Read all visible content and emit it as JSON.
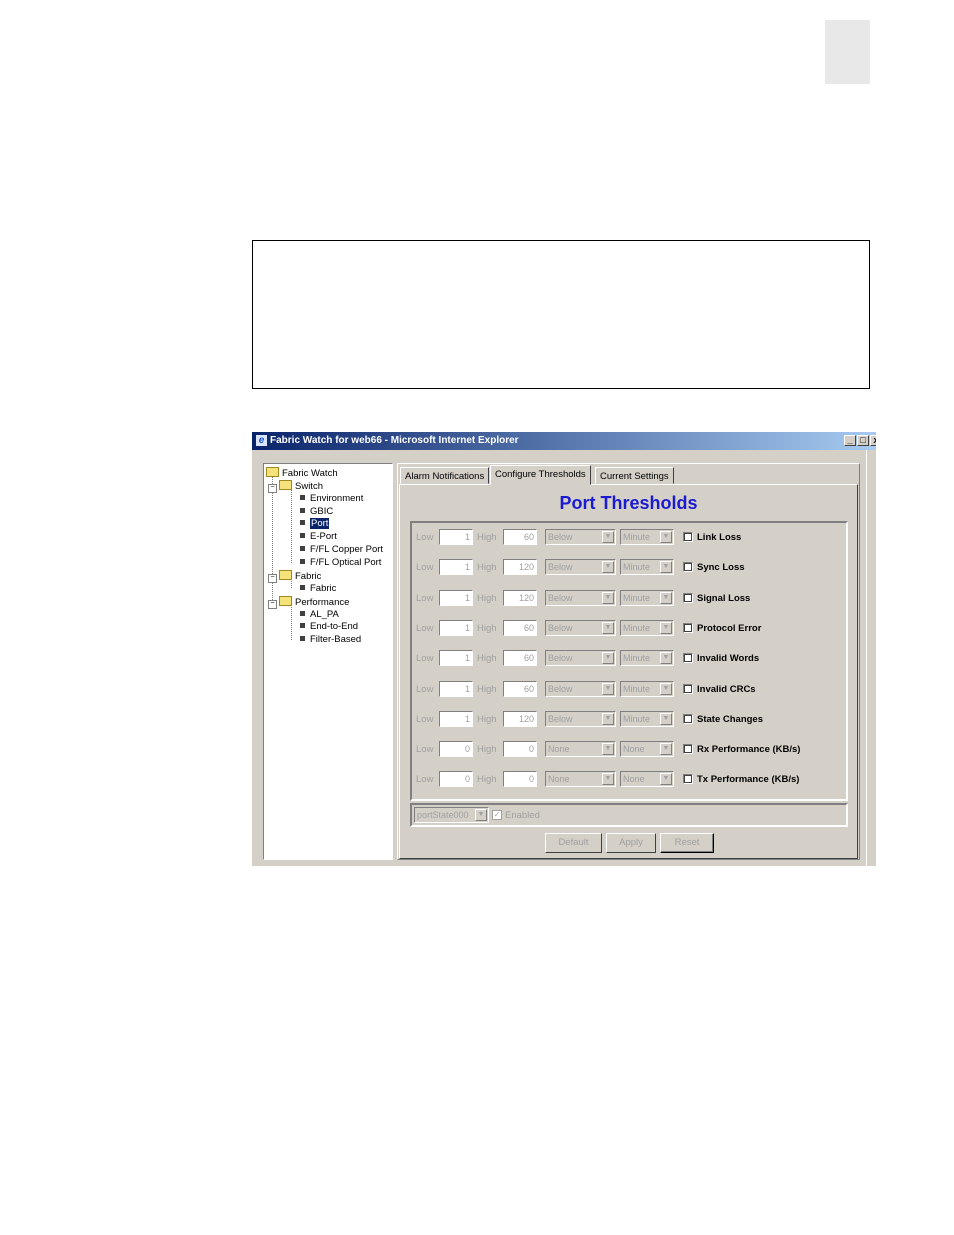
{
  "window": {
    "title": "Fabric Watch for web66 - Microsoft Internet Explorer",
    "min_glyph": "_",
    "max_glyph": "□",
    "close_glyph": "x"
  },
  "tree": {
    "root": "Fabric Watch",
    "switch": "Switch",
    "switch_items": [
      "Environment",
      "GBIC",
      "Port",
      "E-Port",
      "F/FL Copper Port",
      "F/FL Optical Port"
    ],
    "selected": "Port",
    "fabric": "Fabric",
    "fabric_items": [
      "Fabric"
    ],
    "performance": "Performance",
    "performance_items": [
      "AL_PA",
      "End-to-End",
      "Filter-Based"
    ]
  },
  "tabs": [
    "Alarm Notifications",
    "Configure Thresholds",
    "Current Settings"
  ],
  "active_tab": "Configure Thresholds",
  "heading": "Port Thresholds",
  "field_labels": {
    "low": "Low",
    "high": "High"
  },
  "rows": [
    {
      "low": "1",
      "high": "60",
      "cond": "Below",
      "unit": "Minute",
      "label": "Link Loss"
    },
    {
      "low": "1",
      "high": "120",
      "cond": "Below",
      "unit": "Minute",
      "label": "Sync Loss"
    },
    {
      "low": "1",
      "high": "120",
      "cond": "Below",
      "unit": "Minute",
      "label": "Signal Loss"
    },
    {
      "low": "1",
      "high": "60",
      "cond": "Below",
      "unit": "Minute",
      "label": "Protocol Error"
    },
    {
      "low": "1",
      "high": "60",
      "cond": "Below",
      "unit": "Minute",
      "label": "Invalid Words"
    },
    {
      "low": "1",
      "high": "60",
      "cond": "Below",
      "unit": "Minute",
      "label": "Invalid CRCs"
    },
    {
      "low": "1",
      "high": "120",
      "cond": "Below",
      "unit": "Minute",
      "label": "State Changes"
    },
    {
      "low": "0",
      "high": "0",
      "cond": "None",
      "unit": "None",
      "label": "Rx Performance (KB/s)"
    },
    {
      "low": "0",
      "high": "0",
      "cond": "None",
      "unit": "None",
      "label": "Tx Performance (KB/s)"
    }
  ],
  "bottom": {
    "port_select": "portState000",
    "enabled_label": "Enabled",
    "enabled_glyph": "✓"
  },
  "buttons": {
    "default": "Default",
    "apply": "Apply",
    "reset": "Reset"
  },
  "icons": {
    "ie": "e",
    "arrow": "▼",
    "collapse": "−"
  }
}
